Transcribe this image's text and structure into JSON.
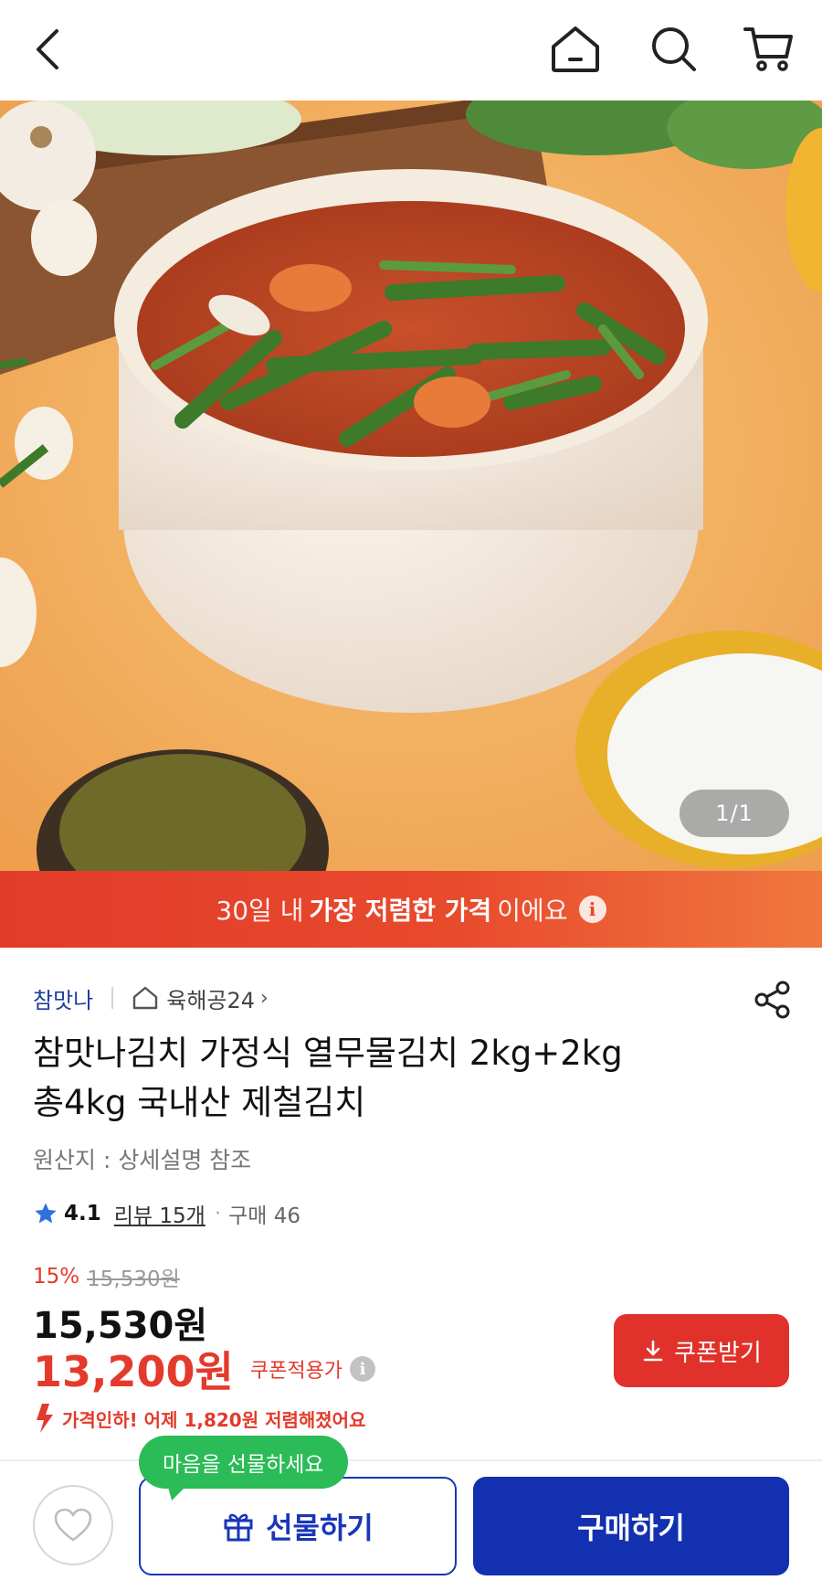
{
  "nav": {
    "back_icon": "back-arrow-icon",
    "home_icon": "home-icon",
    "search_icon": "search-icon",
    "cart_icon": "cart-icon"
  },
  "gallery": {
    "counter": "1/1"
  },
  "banner": {
    "prefix": "30일 내",
    "highlight": "가장 저렴한 가격",
    "suffix": "이에요",
    "info_icon": "i",
    "colors": [
      "#e23b2a",
      "#f0773f"
    ]
  },
  "seller": {
    "brand": "참맛나",
    "shop_name": "육해공24",
    "shop_chevron": "›"
  },
  "product": {
    "title_line1": "참맛나김치 가정식 열무물김치 2kg+2kg",
    "title_line2": "총4kg 국내산 제철김치",
    "origin": "원산지 : 상세설명 참조"
  },
  "rating": {
    "score": "4.1",
    "reviews": "리뷰 15개",
    "separator": "·",
    "purchases": "구매 46"
  },
  "pricing": {
    "discount_rate": "15%",
    "original_price": "15,530원",
    "price": "15,530원",
    "coupon_price": "13,200원",
    "coupon_label": "쿠폰적용가",
    "info_icon": "i",
    "coupon_button": "쿠폰받기",
    "price_drop": "가격인하! 어제 1,820원 저렴해졌어요",
    "accent_color": "#e43a2b"
  },
  "bottom_bar": {
    "tooltip": "마음을 선물하세요",
    "gift_button": "선물하기",
    "buy_button": "구매하기",
    "primary_color": "#1230b0",
    "tooltip_color": "#2bbb57"
  }
}
